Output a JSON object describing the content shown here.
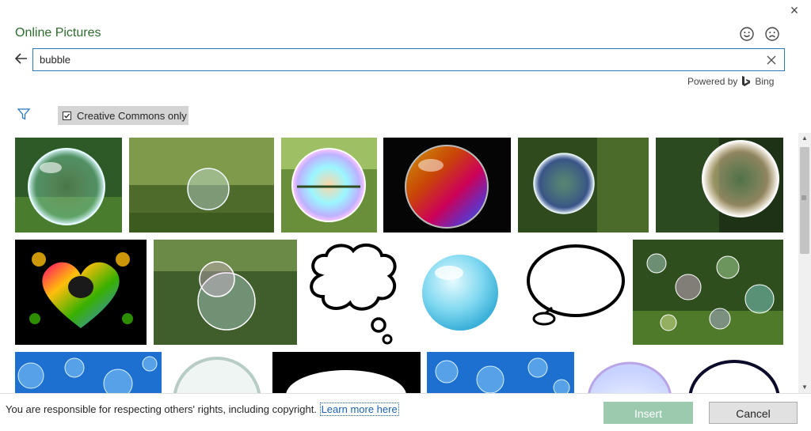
{
  "window": {
    "close_label": "×"
  },
  "header": {
    "title": "Online Pictures"
  },
  "search": {
    "value": "bubble"
  },
  "powered_by": {
    "prefix": "Powered by",
    "brand": "Bing"
  },
  "filters": {
    "creative_commons_label": "Creative Commons only",
    "creative_commons_checked": true
  },
  "icons": {
    "close": "close-icon",
    "smile": "smile-icon",
    "frown": "frown-icon",
    "back": "back-arrow-icon",
    "clear": "clear-icon",
    "bing": "bing-logo-icon",
    "filter": "filter-icon",
    "checkbox": "checkbox-icon"
  },
  "colors": {
    "title_green": "#2e6b2f",
    "search_border": "#2b78c5",
    "link_blue": "#1b62b2",
    "insert_bg": "#9ccaae",
    "cancel_bg": "#e1e1e1",
    "cc_bg": "#d4d4d4"
  },
  "results": [
    {
      "kind": "bubble-green"
    },
    {
      "kind": "bubble-park"
    },
    {
      "kind": "bubble-green"
    },
    {
      "kind": "bubble-dark"
    },
    {
      "kind": "bubble-forest"
    },
    {
      "kind": "bubble-forest"
    },
    {
      "kind": "heart"
    },
    {
      "kind": "bubble-leaves"
    },
    {
      "kind": "thought-cloud"
    },
    {
      "kind": "blue-sphere"
    },
    {
      "kind": "speech-bubble"
    },
    {
      "kind": "many-bubbles"
    },
    {
      "kind": "blue-pattern"
    },
    {
      "kind": "glass-circle"
    },
    {
      "kind": "black-oval"
    },
    {
      "kind": "blue-pattern"
    },
    {
      "kind": "lavender-oval"
    },
    {
      "kind": "outline-oval"
    }
  ],
  "footer": {
    "notice": "You are responsible for respecting others' rights, including copyright.",
    "learn_more": "Learn more here",
    "insert_label": "Insert",
    "cancel_label": "Cancel"
  }
}
